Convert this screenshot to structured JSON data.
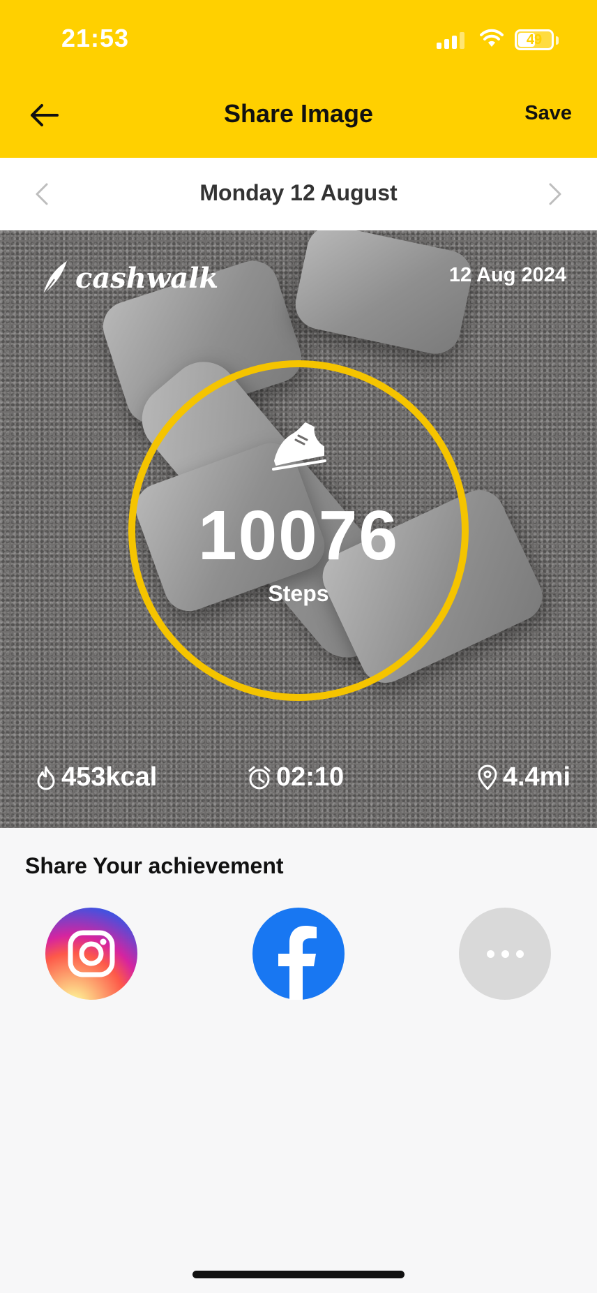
{
  "status_bar": {
    "time": "21:53",
    "battery": "49"
  },
  "nav": {
    "title": "Share Image",
    "save_label": "Save"
  },
  "date_selector": {
    "label": "Monday 12 August"
  },
  "card": {
    "brand": "cashwalk",
    "date": "12 Aug 2024",
    "steps_value": "10076",
    "steps_label": "Steps",
    "calories": "453kcal",
    "duration": "02:10",
    "distance": "4.4mi",
    "ring_color": "#F5C400"
  },
  "share": {
    "title": "Share Your achievement",
    "options": [
      "instagram-icon",
      "facebook-icon",
      "more-icon"
    ]
  },
  "colors": {
    "header": "#FFD000",
    "facebook": "#1877F2"
  }
}
